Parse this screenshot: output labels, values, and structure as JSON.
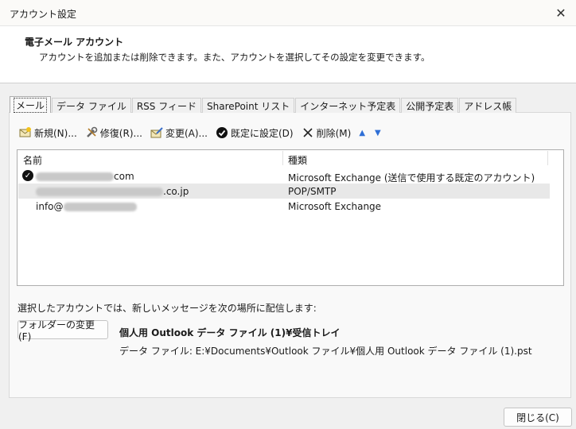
{
  "window": {
    "title": "アカウント設定",
    "close_glyph": "✕"
  },
  "header": {
    "title": "電子メール アカウント",
    "description": "アカウントを追加または削除できます。また、アカウントを選択してその設定を変更できます。"
  },
  "tabs": [
    {
      "label": "メール",
      "active": true
    },
    {
      "label": "データ ファイル"
    },
    {
      "label": "RSS フィード"
    },
    {
      "label": "SharePoint リスト"
    },
    {
      "label": "インターネット予定表"
    },
    {
      "label": "公開予定表"
    },
    {
      "label": "アドレス帳"
    }
  ],
  "toolbar": {
    "new_label": "新規(N)...",
    "repair_label": "修復(R)...",
    "change_label": "変更(A)...",
    "default_label": "既定に設定(D)",
    "delete_label": "削除(M)",
    "up_glyph": "▲",
    "down_glyph": "▼"
  },
  "list": {
    "col_name": "名前",
    "col_type": "種類",
    "rows": [
      {
        "name_suffix": "com",
        "type": "Microsoft Exchange (送信で使用する既定のアカウント)",
        "default": true
      },
      {
        "name_suffix": ".co.jp",
        "type": "POP/SMTP"
      },
      {
        "name_prefix": "info@",
        "type": "Microsoft Exchange"
      }
    ]
  },
  "delivery": {
    "text": "選択したアカウントでは、新しいメッセージを次の場所に配信します:",
    "change_folder_label": "フォルダーの変更(F)",
    "folder": "個人用 Outlook データ ファイル (1)¥受信トレイ",
    "datafile": "データ ファイル: E:¥Documents¥Outlook ファイル¥個人用 Outlook データ ファイル (1).pst"
  },
  "footer": {
    "close_label": "閉じる(C)"
  }
}
